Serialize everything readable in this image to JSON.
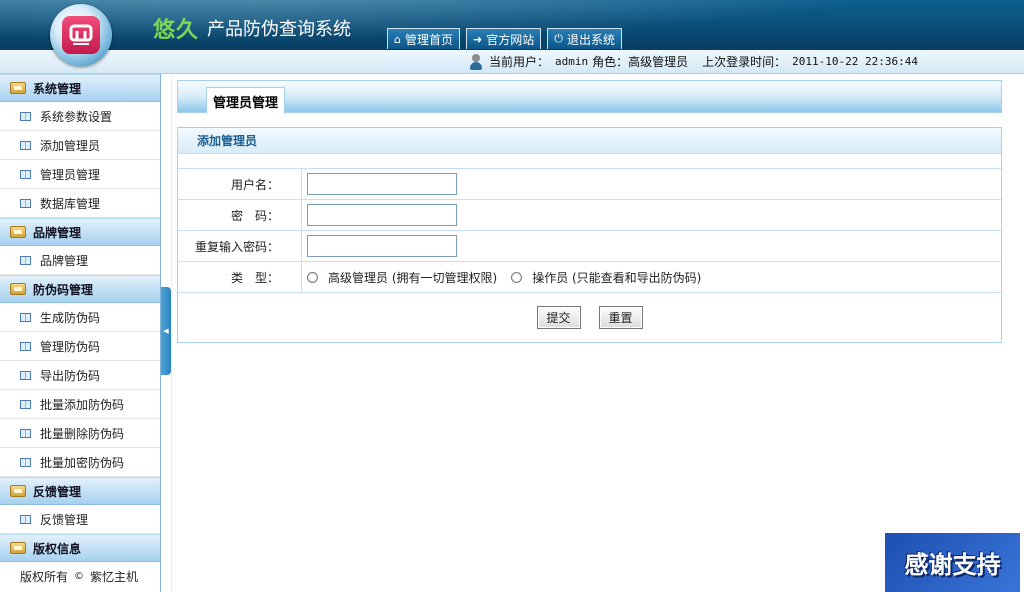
{
  "header": {
    "brand": "悠久",
    "system_name": "产品防伪查询系统",
    "nav": [
      {
        "label": "管理首页",
        "icon": "home-icon"
      },
      {
        "label": "官方网站",
        "icon": "arrow-right-icon"
      },
      {
        "label": "退出系统",
        "icon": "power-icon"
      }
    ]
  },
  "status": {
    "current_user_label": "当前用户：",
    "current_user": "admin",
    "role_label": "角色：",
    "role": "高级管理员",
    "last_login_label": "上次登录时间：",
    "last_login": "2011-10-22 22:36:44"
  },
  "sidebar": {
    "sections": [
      {
        "title": "系统管理",
        "items": [
          "系统参数设置",
          "添加管理员",
          "管理员管理",
          "数据库管理"
        ]
      },
      {
        "title": "品牌管理",
        "items": [
          "品牌管理"
        ]
      },
      {
        "title": "防伪码管理",
        "items": [
          "生成防伪码",
          "管理防伪码",
          "导出防伪码",
          "批量添加防伪码",
          "批量删除防伪码",
          "批量加密防伪码"
        ]
      },
      {
        "title": "反馈管理",
        "items": [
          "反馈管理"
        ]
      },
      {
        "title": "版权信息",
        "items": []
      }
    ],
    "copyright_text": "版权所有",
    "copyright_symbol": "©",
    "copyright_owner": "紫忆主机"
  },
  "main": {
    "panel_title": "管理员管理",
    "form_title": "添加管理员",
    "fields": {
      "username_label": "用户名：",
      "password_label": "密　码：",
      "confirm_label": "重复输入密码：",
      "type_label": "类　型：",
      "username_value": "",
      "password_value": "",
      "confirm_value": ""
    },
    "type_options": [
      "高级管理员 (拥有一切管理权限)",
      "操作员 (只能查看和导出防伪码)"
    ],
    "submit_label": "提交",
    "reset_label": "重置"
  },
  "badge": {
    "text": "感谢支持"
  },
  "colors": {
    "header": "#0a4d77",
    "accent": "#7dd654",
    "sidebar_head": "#a6d1ef",
    "border": "#a8cfe9"
  }
}
